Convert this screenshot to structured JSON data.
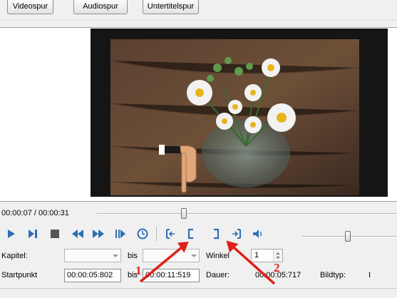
{
  "tabs": [
    {
      "label": "Videospur"
    },
    {
      "label": "Audiospur"
    },
    {
      "label": "Untertitelspur"
    }
  ],
  "player": {
    "time_display": "00:00:07 / 00:00:31",
    "seek_position": 0.226
  },
  "form": {
    "kapitel_label": "Kapitel:",
    "bis_label": "bis",
    "winkel_label": "Winkel",
    "winkel_value": "1",
    "startpunkt_label": "Startpunkt",
    "startpunkt_value": "00:00:05:802",
    "endpunkt_value": "00:00:11:519",
    "dauer_label": "Dauer:",
    "dauer_value": "00:00:05:717",
    "bildtyp_label": "Bildtyp:",
    "bildtyp_value": "I"
  },
  "annotations": {
    "marker_1": "1",
    "marker_2": "2"
  },
  "colors": {
    "accent_blue": "#2f6fb5",
    "annotation_red": "#e0201a"
  }
}
